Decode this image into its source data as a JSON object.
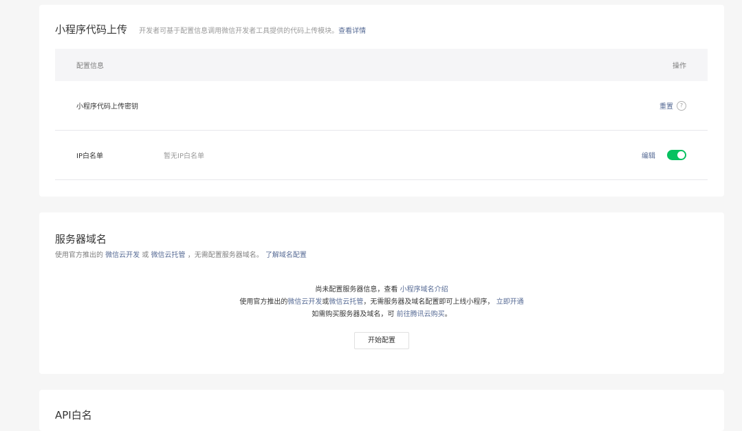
{
  "code_upload": {
    "title": "小程序代码上传",
    "desc": "开发者可基于配置信息调用微信开发者工具提供的代码上传模块。",
    "detail_link": "查看详情",
    "table": {
      "header_left": "配置信息",
      "header_right": "操作",
      "rows": [
        {
          "label": "小程序代码上传密钥",
          "value": "",
          "action": "重置"
        },
        {
          "label": "IP白名单",
          "value": "暂无IP白名单",
          "action": "编辑"
        }
      ]
    },
    "switch_on": true
  },
  "server_domain": {
    "title": "服务器域名",
    "desc_prefix": "使用官方推出的",
    "desc_link1": "微信云开发",
    "desc_or": "或",
    "desc_link2": "微信云托管",
    "desc_suffix": "，无需配置服务器域名。",
    "desc_link3": "了解域名配置",
    "empty": {
      "line1_prefix": "尚未配置服务器信息，查看",
      "line1_link": "小程序域名介绍",
      "line2_prefix": "使用官方推出的",
      "line2_link1": "微信云开发",
      "line2_or": "或",
      "line2_link2": "微信云托管",
      "line2_mid": "，无需服务器及域名配置即可上线小程序，",
      "line2_link3": "立即开通",
      "line3_prefix": "如需购买服务器及域名，可",
      "line3_link": "前往腾讯云购买",
      "line3_suffix": "。"
    },
    "start_button": "开始配置"
  },
  "api_section": {
    "title": "API白名"
  },
  "colors": {
    "accent_green": "#07c160",
    "link_blue": "#576b95"
  }
}
